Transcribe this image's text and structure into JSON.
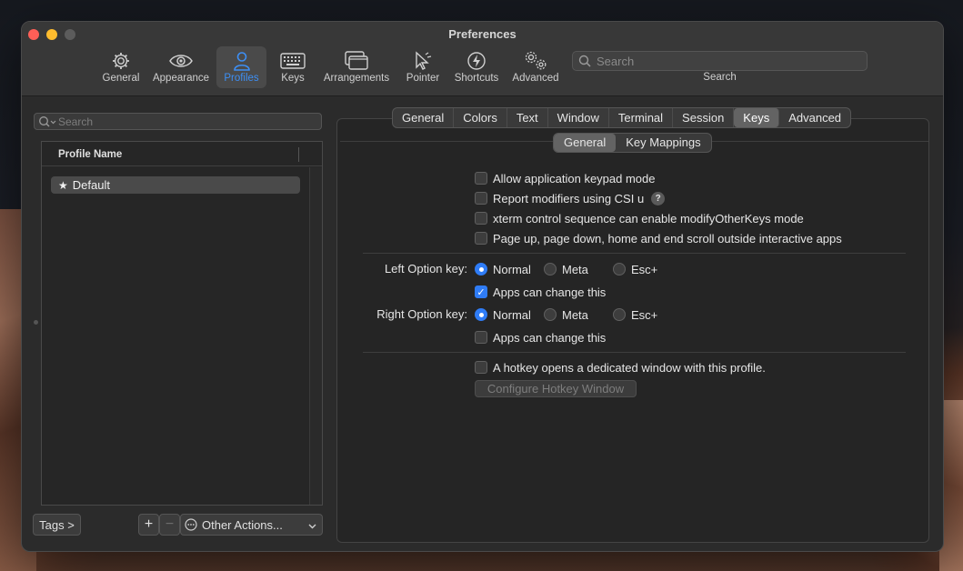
{
  "window": {
    "title": "Preferences"
  },
  "toolbar": {
    "items": [
      {
        "label": "General",
        "icon": "gear-icon",
        "active": false
      },
      {
        "label": "Appearance",
        "icon": "eye-icon",
        "active": false
      },
      {
        "label": "Profiles",
        "icon": "person-icon",
        "active": true
      },
      {
        "label": "Keys",
        "icon": "keyboard-icon",
        "active": false
      },
      {
        "label": "Arrangements",
        "icon": "windows-icon",
        "active": false
      },
      {
        "label": "Pointer",
        "icon": "cursor-icon",
        "active": false
      },
      {
        "label": "Shortcuts",
        "icon": "bolt-icon",
        "active": false
      },
      {
        "label": "Advanced",
        "icon": "gears-icon",
        "active": false
      }
    ],
    "search": {
      "placeholder": "Search",
      "caption": "Search"
    }
  },
  "profiles": {
    "search_placeholder": "Search",
    "column_header": "Profile Name",
    "rows": [
      {
        "name": "Default",
        "is_default": true
      }
    ],
    "tags_button": "Tags >",
    "add_button": "+",
    "remove_button": "−",
    "other_actions": "Other Actions..."
  },
  "tabs": [
    "General",
    "Colors",
    "Text",
    "Window",
    "Terminal",
    "Session",
    "Keys",
    "Advanced"
  ],
  "active_tab": "Keys",
  "subtabs": [
    "General",
    "Key Mappings"
  ],
  "active_subtab": "General",
  "keys_general": {
    "options": [
      {
        "label": "Allow application keypad mode",
        "checked": false
      },
      {
        "label": "Report modifiers using CSI u",
        "checked": false,
        "help": "?"
      },
      {
        "label": "xterm control sequence can enable modifyOtherKeys mode",
        "checked": false
      },
      {
        "label": "Page up, page down, home and end scroll outside interactive apps",
        "checked": false
      }
    ],
    "left_option": {
      "label": "Left Option key:",
      "choices": [
        "Normal",
        "Meta",
        "Esc+"
      ],
      "selected": "Normal",
      "apps_can_change": {
        "label": "Apps can change this",
        "checked": true
      }
    },
    "right_option": {
      "label": "Right Option key:",
      "choices": [
        "Normal",
        "Meta",
        "Esc+"
      ],
      "selected": "Normal",
      "apps_can_change": {
        "label": "Apps can change this",
        "checked": false
      }
    },
    "hotkey": {
      "label": "A hotkey opens a dedicated window with this profile.",
      "checked": false
    },
    "configure_hotkey_button": "Configure Hotkey Window"
  },
  "colors": {
    "accent": "#2f7cf6",
    "active_toolbar": "#3d8ff5"
  }
}
